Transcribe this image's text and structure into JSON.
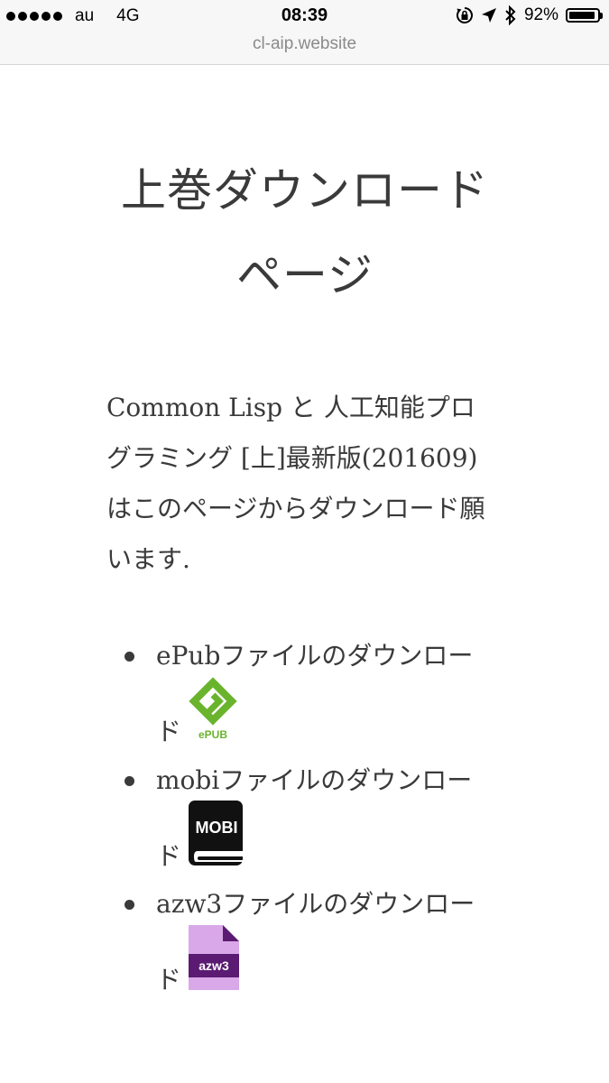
{
  "status_bar": {
    "carrier": "au",
    "network": "4G",
    "time": "08:39",
    "battery": "92%",
    "battery_level": 0.92,
    "icons": [
      "signal-dots-icon",
      "rotation-lock-icon",
      "location-arrow-icon",
      "bluetooth-icon",
      "battery-icon"
    ]
  },
  "browser": {
    "url": "cl-aip.website"
  },
  "page": {
    "title_line1": "上巻ダウンロード",
    "title_line2": "ページ",
    "intro_line1": "Common Lisp と 人工知能プロ",
    "intro_line2": "グラミング [上]最新版(201609)",
    "intro_line3": "はこのページからダウンロード願",
    "intro_line4": "います.",
    "downloads": [
      {
        "label": "ePubファイルのダウンロー",
        "suffix": "ド",
        "icon": "epub-icon",
        "icon_text": "ePUB",
        "color": "#6ab42d"
      },
      {
        "label": "mobiファイルのダウンロー",
        "suffix": "ド",
        "icon": "mobi-icon",
        "icon_text": "MOBI",
        "color": "#111111"
      },
      {
        "label": "azw3ファイルのダウンロー",
        "suffix": "ド",
        "icon": "azw3-icon",
        "icon_text": "azw3",
        "color": "#5b1b72",
        "accent": "#d9a8e8"
      }
    ]
  }
}
